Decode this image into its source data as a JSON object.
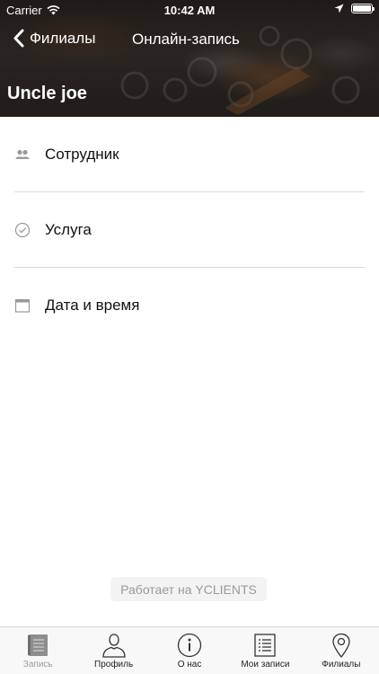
{
  "status_bar": {
    "carrier": "Carrier",
    "time": "10:42 AM"
  },
  "nav": {
    "back_label": "Филиалы",
    "title": "Онлайн-запись"
  },
  "branch": {
    "name": "Uncle joe"
  },
  "booking_items": [
    {
      "label": "Сотрудник",
      "icon": "people-icon"
    },
    {
      "label": "Услуга",
      "icon": "check-circle-icon"
    },
    {
      "label": "Дата и время",
      "icon": "calendar-icon"
    }
  ],
  "powered_by": "Работает на YCLIENTS",
  "tabs": [
    {
      "label": "Запись",
      "icon": "book-icon",
      "active": true
    },
    {
      "label": "Профиль",
      "icon": "person-icon",
      "active": false
    },
    {
      "label": "О нас",
      "icon": "info-icon",
      "active": false
    },
    {
      "label": "Мои записи",
      "icon": "list-icon",
      "active": false
    },
    {
      "label": "Филиалы",
      "icon": "map-pin-icon",
      "active": false
    }
  ],
  "colors": {
    "header_overlay": "#2b2622",
    "separator": "#dcdcdc",
    "icon_gray": "#9a9a9a",
    "tab_active_text": "#9a9a9a",
    "tab_text": "#222222"
  }
}
